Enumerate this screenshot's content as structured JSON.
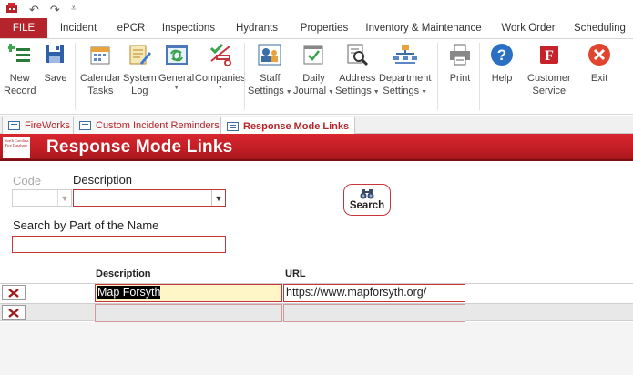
{
  "quick_access": {
    "undo_symbol": "↶",
    "redo_symbol": "↷",
    "customize_symbol": "⩡"
  },
  "ribbon_tabs": [
    "FILE",
    "Incident",
    "ePCR",
    "Inspections",
    "Hydrants",
    "Properties",
    "Inventory & Maintenance",
    "Work Order",
    "Scheduling"
  ],
  "ribbon_buttons": {
    "new_record": "New\nRecord",
    "save": "Save",
    "calendar_tasks": "Calendar\nTasks",
    "system_log": "System\nLog",
    "general": "General",
    "companies": "Companies",
    "staff_settings": "Staff\nSettings",
    "daily_journal": "Daily\nJournal",
    "address_settings": "Address\nSettings",
    "department_settings": "Department\nSettings",
    "print": "Print",
    "help": "Help",
    "customer_service": "Customer\nService",
    "exit": "Exit"
  },
  "doc_tabs": [
    "FireWorks",
    "Custom Incident Reminders",
    "Response Mode Links"
  ],
  "form": {
    "logo_text": "North Carolina Fire Database",
    "title": "Response Mode Links",
    "code_label": "Code",
    "description_label": "Description",
    "search_button": "Search",
    "search_part_label": "Search by Part of the Name",
    "search_part_value": ""
  },
  "table": {
    "headers": {
      "description": "Description",
      "url": "URL"
    },
    "rows": [
      {
        "description": "Map Forsyth",
        "url": "https://www.mapforsyth.org/"
      },
      {
        "description": "",
        "url": ""
      }
    ]
  },
  "colors": {
    "accent_red": "#b5242a",
    "header_red": "#c11d24",
    "current_field": "#fff6c8"
  }
}
